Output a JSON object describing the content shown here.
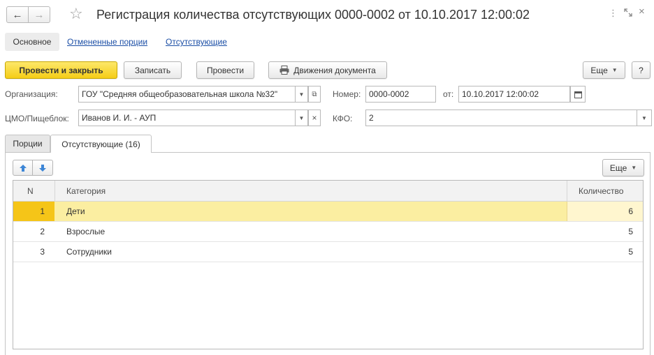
{
  "window": {
    "title": "Регистрация количества отсутствующих 0000-0002 от 10.10.2017 12:00:02",
    "back_icon": "arrow-left-icon",
    "forward_icon": "arrow-right-icon",
    "favorite_icon": "star-icon",
    "more_icon": "more-vertical-icon",
    "expand_icon": "expand-icon",
    "close_icon": "close-icon"
  },
  "sections": {
    "main": "Основное",
    "cancelled_portions": "Отмененные порции",
    "absent": "Отсутствующие"
  },
  "toolbar": {
    "post_and_close": "Провести и закрыть",
    "save": "Записать",
    "post": "Провести",
    "movements": "Движения документа",
    "more": "Еще",
    "help": "?"
  },
  "form": {
    "organization_label": "Организация:",
    "organization_value": "ГОУ \"Средняя общеобразовательная школа №32\"",
    "number_label": "Номер:",
    "number_value": "0000-0002",
    "date_label": "от:",
    "date_value": "10.10.2017 12:00:02",
    "cmo_label": "ЦМО/Пищеблок:",
    "cmo_value": "Иванов И. И. - АУП",
    "kfo_label": "КФО:",
    "kfo_value": "2"
  },
  "tabs": [
    {
      "label": "Порции",
      "active": false
    },
    {
      "label": "Отсутствующие (16)",
      "active": true
    }
  ],
  "table_toolbar": {
    "more": "Еще"
  },
  "table": {
    "columns": [
      "N",
      "Категория",
      "Количество"
    ],
    "rows": [
      {
        "n": "1",
        "category": "Дети",
        "quantity": "6",
        "selected": true
      },
      {
        "n": "2",
        "category": "Взрослые",
        "quantity": "5",
        "selected": false
      },
      {
        "n": "3",
        "category": "Сотрудники",
        "quantity": "5",
        "selected": false
      }
    ]
  },
  "colors": {
    "primary_button": "#f5cd17",
    "selected_row": "#fbeea1",
    "selected_n_cell": "#f5c518",
    "link": "#1c4fa6"
  }
}
